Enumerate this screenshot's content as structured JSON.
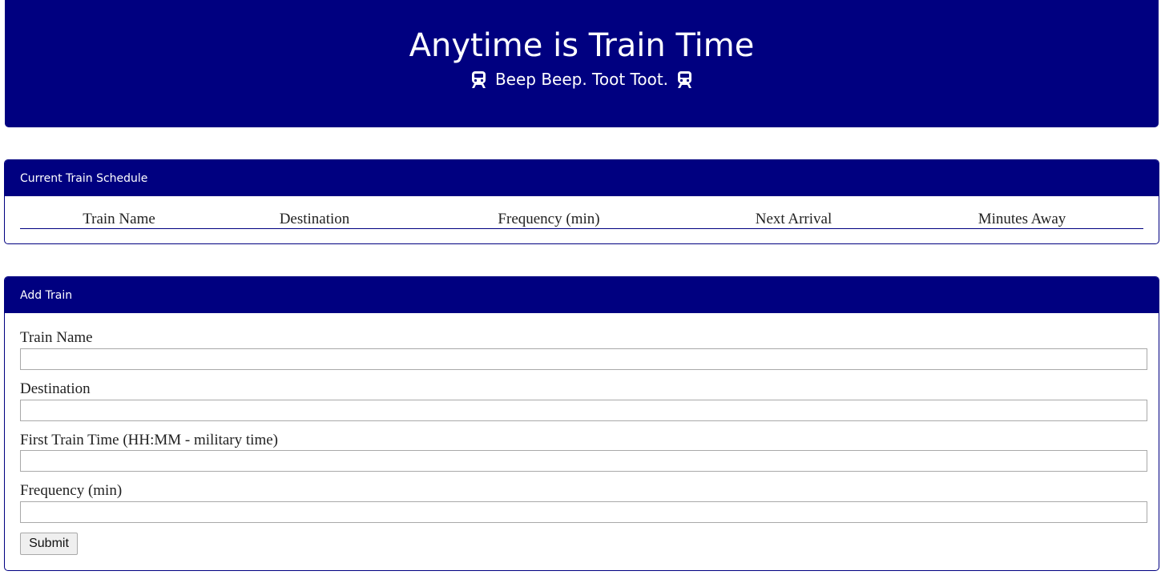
{
  "header": {
    "title": "Anytime is Train Time",
    "subtitle": "Beep Beep. Toot Toot.",
    "icon": "train-icon",
    "background": "#000080"
  },
  "schedule": {
    "heading": "Current Train Schedule",
    "columns": [
      "Train Name",
      "Destination",
      "Frequency (min)",
      "Next Arrival",
      "Minutes Away"
    ],
    "rows": []
  },
  "add_train": {
    "heading": "Add Train",
    "fields": {
      "name": {
        "label": "Train Name",
        "value": ""
      },
      "destination": {
        "label": "Destination",
        "value": ""
      },
      "first_time": {
        "label": "First Train Time (HH:MM - military time)",
        "value": ""
      },
      "frequency": {
        "label": "Frequency (min)",
        "value": ""
      }
    },
    "submit_label": "Submit"
  }
}
